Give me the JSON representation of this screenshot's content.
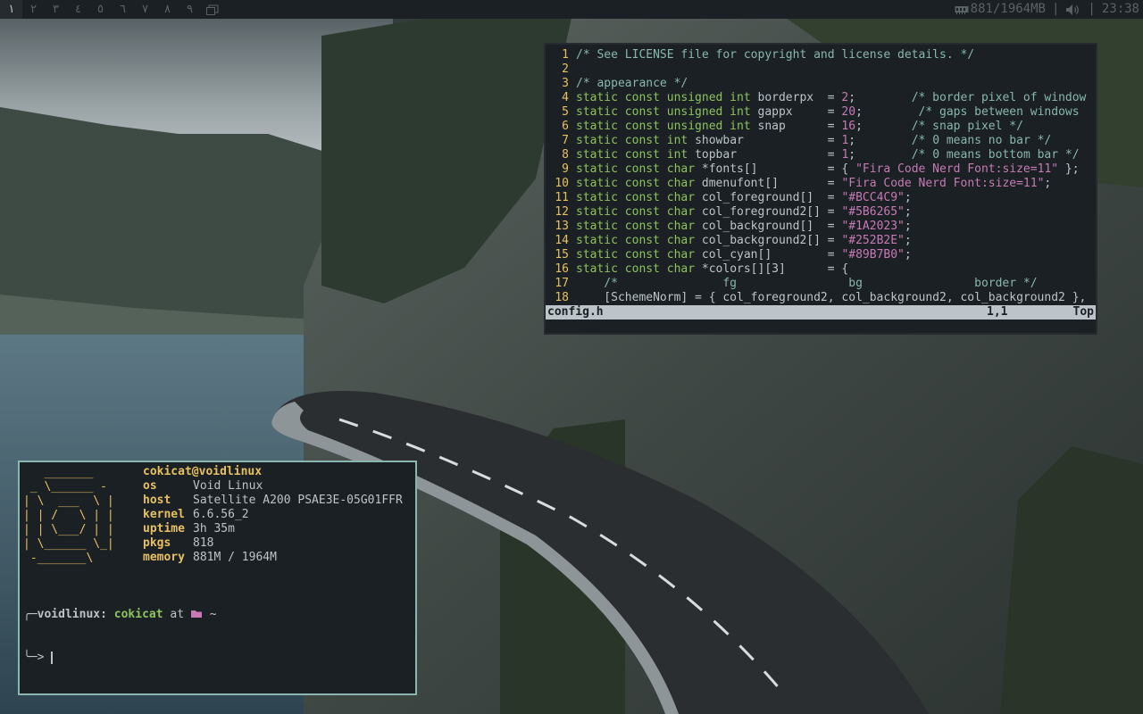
{
  "bar": {
    "tags": [
      "١",
      "٢",
      "٣",
      "٤",
      "٥",
      "٦",
      "٧",
      "٨",
      "٩"
    ],
    "active_tag": 0,
    "memory": "881/1964MB",
    "separator": "|",
    "clock": "23:38"
  },
  "vim": {
    "lines": [
      {
        "n": "1",
        "parts": [
          [
            "cm",
            "/* See LICENSE file for copyright and license details. */"
          ]
        ]
      },
      {
        "n": "2",
        "parts": []
      },
      {
        "n": "3",
        "parts": [
          [
            "cm",
            "/* appearance */"
          ]
        ]
      },
      {
        "n": "4",
        "parts": [
          [
            "kw",
            "static const unsigned int"
          ],
          [
            "",
            "borderpx  = "
          ],
          [
            "nm",
            "2"
          ],
          [
            "",
            ";        "
          ],
          [
            "cm",
            "/* border pixel of window"
          ]
        ]
      },
      {
        "n": "5",
        "parts": [
          [
            "kw",
            "static const unsigned int"
          ],
          [
            "",
            "gappx     = "
          ],
          [
            "nm",
            "20"
          ],
          [
            "",
            ";        "
          ],
          [
            "cm",
            "/* gaps between windows"
          ]
        ]
      },
      {
        "n": "6",
        "parts": [
          [
            "kw",
            "static const unsigned int"
          ],
          [
            "",
            "snap      = "
          ],
          [
            "nm",
            "16"
          ],
          [
            "",
            ";       "
          ],
          [
            "cm",
            "/* snap pixel */"
          ]
        ]
      },
      {
        "n": "7",
        "parts": [
          [
            "kw",
            "static const int"
          ],
          [
            "",
            "showbar            = "
          ],
          [
            "nm",
            "1"
          ],
          [
            "",
            ";        "
          ],
          [
            "cm",
            "/* 0 means no bar */"
          ]
        ]
      },
      {
        "n": "8",
        "parts": [
          [
            "kw",
            "static const int"
          ],
          [
            "",
            "topbar             = "
          ],
          [
            "nm",
            "1"
          ],
          [
            "",
            ";        "
          ],
          [
            "cm",
            "/* 0 means bottom bar */"
          ]
        ]
      },
      {
        "n": "9",
        "parts": [
          [
            "kw",
            "static const char"
          ],
          [
            "",
            "*fonts[]          = { "
          ],
          [
            "st",
            "\"Fira Code Nerd Font:size=11\""
          ],
          [
            "",
            " };"
          ]
        ]
      },
      {
        "n": "10",
        "parts": [
          [
            "kw",
            "static const char"
          ],
          [
            "",
            "dmenufont[]       = "
          ],
          [
            "st",
            "\"Fira Code Nerd Font:size=11\""
          ],
          [
            "",
            ";"
          ]
        ]
      },
      {
        "n": "11",
        "parts": [
          [
            "kw",
            "static const char"
          ],
          [
            "",
            "col_foreground[]  = "
          ],
          [
            "st",
            "\"#BCC4C9\""
          ],
          [
            "",
            ";"
          ]
        ]
      },
      {
        "n": "12",
        "parts": [
          [
            "kw",
            "static const char"
          ],
          [
            "",
            "col_foreground2[] = "
          ],
          [
            "st",
            "\"#5B6265\""
          ],
          [
            "",
            ";"
          ]
        ]
      },
      {
        "n": "13",
        "parts": [
          [
            "kw",
            "static const char"
          ],
          [
            "",
            "col_background[]  = "
          ],
          [
            "st",
            "\"#1A2023\""
          ],
          [
            "",
            ";"
          ]
        ]
      },
      {
        "n": "14",
        "parts": [
          [
            "kw",
            "static const char"
          ],
          [
            "",
            "col_background2[] = "
          ],
          [
            "st",
            "\"#252B2E\""
          ],
          [
            "",
            ";"
          ]
        ]
      },
      {
        "n": "15",
        "parts": [
          [
            "kw",
            "static const char"
          ],
          [
            "",
            "col_cyan[]        = "
          ],
          [
            "st",
            "\"#89B7B0\""
          ],
          [
            "",
            ";"
          ]
        ]
      },
      {
        "n": "16",
        "parts": [
          [
            "kw",
            "static const char"
          ],
          [
            "",
            "*colors[][3]      = {"
          ]
        ]
      },
      {
        "n": "17",
        "parts": [
          [
            "cm",
            "    /*               fg                bg                border */"
          ]
        ]
      },
      {
        "n": "18",
        "parts": [
          [
            "",
            "    [SchemeNorm] = { col_foreground2, col_background2, col_background2 },"
          ]
        ]
      }
    ],
    "status": {
      "filename": "config.h",
      "position": "1,1",
      "percent": "Top"
    }
  },
  "terminal": {
    "logo": [
      "   _______",
      " _ \\______ -",
      "| \\  ___  \\ |",
      "| | /   \\ | |",
      "| | \\___/ | |",
      "| \\______ \\_|",
      " -_______\\"
    ],
    "userhost": "cokicat@voidlinux",
    "info": [
      {
        "key": "os",
        "value": "Void Linux"
      },
      {
        "key": "host",
        "value": "Satellite A200 PSAE3E-05G01FFR"
      },
      {
        "key": "kernel",
        "value": "6.6.56_2"
      },
      {
        "key": "uptime",
        "value": "3h 35m"
      },
      {
        "key": "pkgs",
        "value": "818"
      },
      {
        "key": "memory",
        "value": "881M / 1964M"
      }
    ],
    "prompt": {
      "host": "voidlinux:",
      "user": "cokicat",
      "at": "at",
      "dir": "~"
    }
  },
  "colors": {
    "foreground": "#BCC4C9",
    "foreground2": "#5B6265",
    "background": "#1A2023",
    "background2": "#252B2E",
    "cyan": "#89B7B0"
  }
}
